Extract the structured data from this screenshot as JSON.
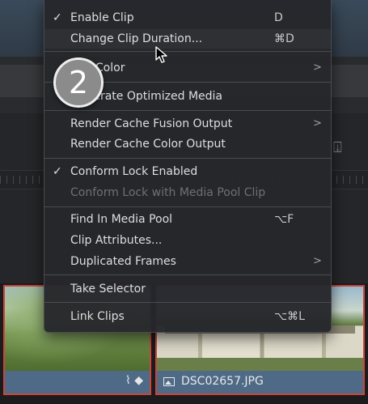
{
  "context_menu": {
    "items": [
      {
        "label": "Enable Clip",
        "shortcut": "D",
        "checked": true
      },
      {
        "label": "Change Clip Duration...",
        "shortcut": "⌘D"
      },
      {
        "label": "Clip Color",
        "submenu": true
      },
      {
        "label": "Generate Optimized Media"
      },
      {
        "label": "Render Cache Fusion Output",
        "submenu": true
      },
      {
        "label": "Render Cache Color Output"
      },
      {
        "label": "Conform Lock Enabled",
        "checked": true
      },
      {
        "label": "Conform Lock with Media Pool Clip",
        "disabled": true
      },
      {
        "label": "Find In Media Pool",
        "shortcut": "⌥F"
      },
      {
        "label": "Clip Attributes..."
      },
      {
        "label": "Duplicated Frames",
        "submenu": true
      },
      {
        "label": "Take Selector"
      },
      {
        "label": "Link Clips",
        "shortcut": "⌥⌘L"
      }
    ]
  },
  "step_badge": "2",
  "timeline": {
    "clip_right_name": "DSC02657.JPG"
  },
  "colors": {
    "clip_border": "#c8463c",
    "clip_bar": "#4e6a86",
    "menu_bg": "#26272b"
  },
  "icons": {
    "check": "checkmark-icon",
    "submenu": "chevron-right-icon",
    "cursor": "mouse-pointer-icon",
    "clip_image": "image-icon"
  }
}
